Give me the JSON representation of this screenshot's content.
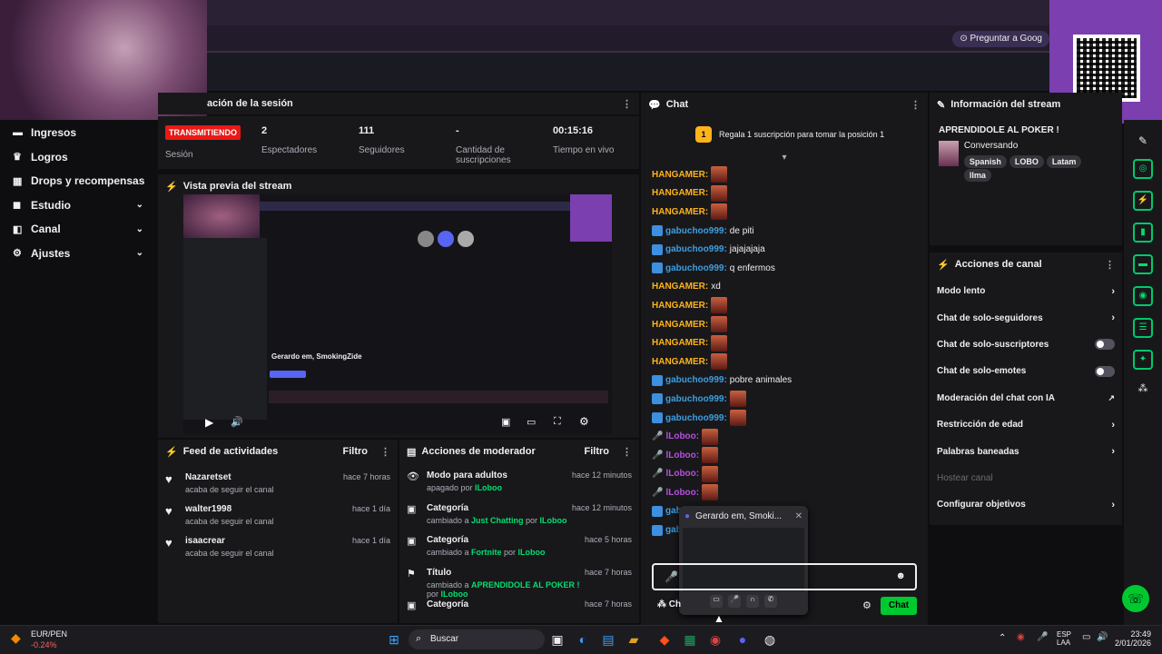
{
  "header": {
    "ask_button": "Preguntar a Goog"
  },
  "sidebar": {
    "items": [
      {
        "label": "Ingresos",
        "icon": "dollar-icon",
        "chev": false
      },
      {
        "label": "Logros",
        "icon": "trophy-icon",
        "chev": false
      },
      {
        "label": "Drops y recompensas",
        "icon": "gift-icon",
        "chev": false
      },
      {
        "label": "Estudio",
        "icon": "studio-icon",
        "chev": true
      },
      {
        "label": "Canal",
        "icon": "channel-icon",
        "chev": true
      },
      {
        "label": "Ajustes",
        "icon": "gear-icon",
        "chev": true
      }
    ]
  },
  "session": {
    "title": "ación de la sesión",
    "live_badge": "TRANSMITIENDO",
    "session_label": "Sesión",
    "stats": [
      {
        "value": "2",
        "label": "Espectadores"
      },
      {
        "value": "111",
        "label": "Seguidores"
      },
      {
        "value": "-",
        "label": "Cantidad de suscripciones"
      },
      {
        "value": "00:15:16",
        "label": "Tiempo en vivo"
      }
    ]
  },
  "preview": {
    "title": "Vista previa del stream",
    "inner_title": "Gerardo em, SmokingZide"
  },
  "activity": {
    "title": "Feed de actividades",
    "filter": "Filtro",
    "items": [
      {
        "name": "Nazaretset",
        "sub": "acaba de seguir el canal",
        "time": "hace 7 horas"
      },
      {
        "name": "walter1998",
        "sub": "acaba de seguir el canal",
        "time": "hace 1 día"
      },
      {
        "name": "isaacrear",
        "sub": "acaba de seguir el canal",
        "time": "hace 1 día"
      }
    ]
  },
  "modactions": {
    "title": "Acciones de moderador",
    "filter": "Filtro",
    "items": [
      {
        "name": "Modo para adultos",
        "pre": "apagado por ",
        "hl": "",
        "mid": "",
        "user": "lLoboo",
        "time": "hace 12 minutos"
      },
      {
        "name": "Categoría",
        "pre": "cambiado a ",
        "hl": "Just Chatting",
        "mid": " por ",
        "user": "lLoboo",
        "time": "hace 12 minutos"
      },
      {
        "name": "Categoría",
        "pre": "cambiado a ",
        "hl": "Fortnite",
        "mid": " por ",
        "user": "lLoboo",
        "time": "hace 5 horas"
      },
      {
        "name": "Título",
        "pre": "cambiado a ",
        "hl": "APRENDIDOLE AL POKER !",
        "mid": " por ",
        "user": "lLoboo",
        "time": "hace 7 horas"
      },
      {
        "name": "Categoría",
        "pre": "",
        "hl": "",
        "mid": "",
        "user": "",
        "time": "hace 7 horas"
      }
    ]
  },
  "chat": {
    "title": "Chat",
    "sub_banner": "Regala 1 suscripción para tomar la posición 1",
    "sub_rank": "1",
    "messages": [
      {
        "user": "HANGAMER:",
        "text": "",
        "emote": true,
        "color": "#ffb31a",
        "type": "plain"
      },
      {
        "user": "HANGAMER:",
        "text": "",
        "emote": true,
        "color": "#ffb31a",
        "type": "plain"
      },
      {
        "user": "HANGAMER:",
        "text": "",
        "emote": true,
        "color": "#ffb31a",
        "type": "plain"
      },
      {
        "user": "gabuchoo999:",
        "text": "de piti",
        "emote": false,
        "color": "#3d9ee0",
        "type": "badge"
      },
      {
        "user": "gabuchoo999:",
        "text": "jajajajaja",
        "emote": false,
        "color": "#3d9ee0",
        "type": "badge"
      },
      {
        "user": "gabuchoo999:",
        "text": "q enfermos",
        "emote": false,
        "color": "#3d9ee0",
        "type": "badge"
      },
      {
        "user": "HANGAMER:",
        "text": "xd",
        "emote": false,
        "color": "#ffb31a",
        "type": "plain"
      },
      {
        "user": "HANGAMER:",
        "text": "",
        "emote": true,
        "color": "#ffb31a",
        "type": "plain"
      },
      {
        "user": "HANGAMER:",
        "text": "",
        "emote": true,
        "color": "#ffb31a",
        "type": "plain"
      },
      {
        "user": "HANGAMER:",
        "text": "",
        "emote": true,
        "color": "#ffb31a",
        "type": "plain"
      },
      {
        "user": "HANGAMER:",
        "text": "",
        "emote": true,
        "color": "#ffb31a",
        "type": "plain"
      },
      {
        "user": "gabuchoo999:",
        "text": "pobre animales",
        "emote": false,
        "color": "#3d9ee0",
        "type": "badge"
      },
      {
        "user": "gabuchoo999:",
        "text": "",
        "emote": true,
        "color": "#3d9ee0",
        "type": "badge"
      },
      {
        "user": "gabuchoo999:",
        "text": "",
        "emote": true,
        "color": "#3d9ee0",
        "type": "badge"
      },
      {
        "user": "lLoboo:",
        "text": "",
        "emote": true,
        "color": "#b74ee0",
        "type": "mic"
      },
      {
        "user": "lLoboo:",
        "text": "",
        "emote": true,
        "color": "#b74ee0",
        "type": "mic"
      },
      {
        "user": "lLoboo:",
        "text": "",
        "emote": true,
        "color": "#b74ee0",
        "type": "mic"
      },
      {
        "user": "lLoboo:",
        "text": "",
        "emote": true,
        "color": "#b74ee0",
        "type": "mic"
      },
      {
        "user": "gab",
        "text": "",
        "emote": false,
        "color": "#3d9ee0",
        "type": "badge"
      },
      {
        "user": "gab",
        "text": "",
        "emote": false,
        "color": "#3d9ee0",
        "type": "badge"
      }
    ],
    "send": "Chat",
    "cursor_label": "Ch"
  },
  "popup": {
    "title": "Gerardo em, Smoki..."
  },
  "info": {
    "title": "Información del stream",
    "stream_title": "APRENDIDOLE AL POKER !",
    "category": "Conversando",
    "tags": [
      "Spanish",
      "LOBO",
      "Latam",
      "llma"
    ]
  },
  "actions": {
    "title": "Acciones de canal",
    "items": [
      {
        "label": "Modo lento",
        "kind": "chev"
      },
      {
        "label": "Chat de solo-seguidores",
        "kind": "chev"
      },
      {
        "label": "Chat de solo-suscriptores",
        "kind": "toggle"
      },
      {
        "label": "Chat de solo-emotes",
        "kind": "toggle"
      },
      {
        "label": "Moderación del chat con IA",
        "kind": "ext"
      },
      {
        "label": "Restricción de edad",
        "kind": "chev"
      },
      {
        "label": "Palabras baneadas",
        "kind": "chev"
      },
      {
        "label": "Hostear canal",
        "kind": "disabled"
      },
      {
        "label": "Configurar objetivos",
        "kind": "chev"
      }
    ]
  },
  "taskbar": {
    "ticker_name": "EUR/PEN",
    "ticker_value": "-0.24%",
    "search": "Buscar",
    "lang1": "ESP",
    "lang2": "LAA",
    "time": "23:49",
    "date": "2/01/2026"
  }
}
